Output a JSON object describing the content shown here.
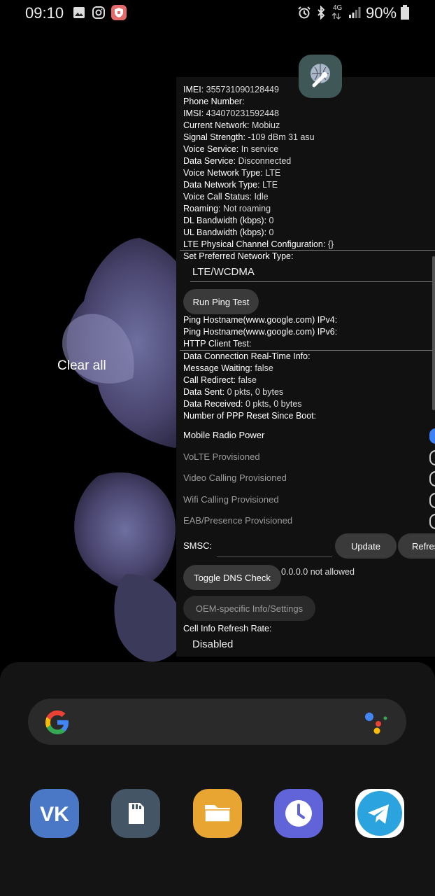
{
  "status_bar": {
    "time": "09:10",
    "battery": "90%",
    "network": "4G"
  },
  "recents": {
    "clear_all": "Clear all"
  },
  "phone_info": {
    "rows": [
      {
        "k": "IMEI:",
        "v": "355731090128449"
      },
      {
        "k": "Phone Number:",
        "v": ""
      },
      {
        "k": "IMSI:",
        "v": "434070231592448"
      },
      {
        "k": "Current Network:",
        "v": "Mobiuz"
      },
      {
        "k": "Signal Strength:",
        "v": "-109 dBm   31 asu"
      },
      {
        "k": "Voice Service:",
        "v": "In service"
      },
      {
        "k": "Data Service:",
        "v": "Disconnected"
      },
      {
        "k": "Voice Network Type:",
        "v": "LTE"
      },
      {
        "k": "Data Network Type:",
        "v": "LTE"
      },
      {
        "k": "Voice Call Status:",
        "v": "Idle"
      },
      {
        "k": "Roaming:",
        "v": "Not roaming"
      },
      {
        "k": "DL Bandwidth (kbps):",
        "v": "0"
      },
      {
        "k": "UL Bandwidth (kbps):",
        "v": "0"
      },
      {
        "k": "LTE Physical Channel Configuration:",
        "v": "{}"
      }
    ],
    "preferred_label": "Set Preferred Network Type:",
    "preferred_value": "LTE/WCDMA",
    "ping_button": "Run Ping Test",
    "ping_rows": [
      {
        "k": "Ping Hostname(www.google.com) IPv4:",
        "v": ""
      },
      {
        "k": "Ping Hostname(www.google.com) IPv6:",
        "v": ""
      },
      {
        "k": "HTTP Client Test:",
        "v": ""
      }
    ],
    "data_rows": [
      {
        "k": "Data Connection Real-Time Info:",
        "v": ""
      },
      {
        "k": "Message Waiting:",
        "v": "false"
      },
      {
        "k": "Call Redirect:",
        "v": "false"
      },
      {
        "k": "Data Sent:",
        "v": "0 pkts, 0 bytes"
      },
      {
        "k": "Data Received:",
        "v": "0 pkts, 0 bytes"
      },
      {
        "k": "Number of PPP Reset Since Boot:",
        "v": ""
      }
    ],
    "toggles": [
      {
        "label": "Mobile Radio Power",
        "on": true,
        "enabled": true
      },
      {
        "label": "VoLTE Provisioned",
        "on": false,
        "enabled": false
      },
      {
        "label": "Video Calling Provisioned",
        "on": false,
        "enabled": false
      },
      {
        "label": "Wifi Calling Provisioned",
        "on": false,
        "enabled": false
      },
      {
        "label": "EAB/Presence Provisioned",
        "on": false,
        "enabled": false
      }
    ],
    "smsc_label": "SMSC:",
    "update_button": "Update",
    "refresh_button": "Refres",
    "dns_button": "Toggle DNS Check",
    "dns_status": "0.0.0.0 not allowed",
    "oem_button": "OEM-specific Info/Settings",
    "refresh_rate_label": "Cell Info Refresh Rate:",
    "refresh_rate_value": "Disabled"
  },
  "dock": {
    "apps": [
      {
        "name": "vk-icon",
        "color": "#4a78c6"
      },
      {
        "name": "sd-card-icon",
        "color": "#445566"
      },
      {
        "name": "files-icon",
        "color": "#e8a531"
      },
      {
        "name": "clock-icon",
        "color": "#6163d8"
      },
      {
        "name": "telegram-icon",
        "color": "#2aa3df"
      }
    ]
  }
}
